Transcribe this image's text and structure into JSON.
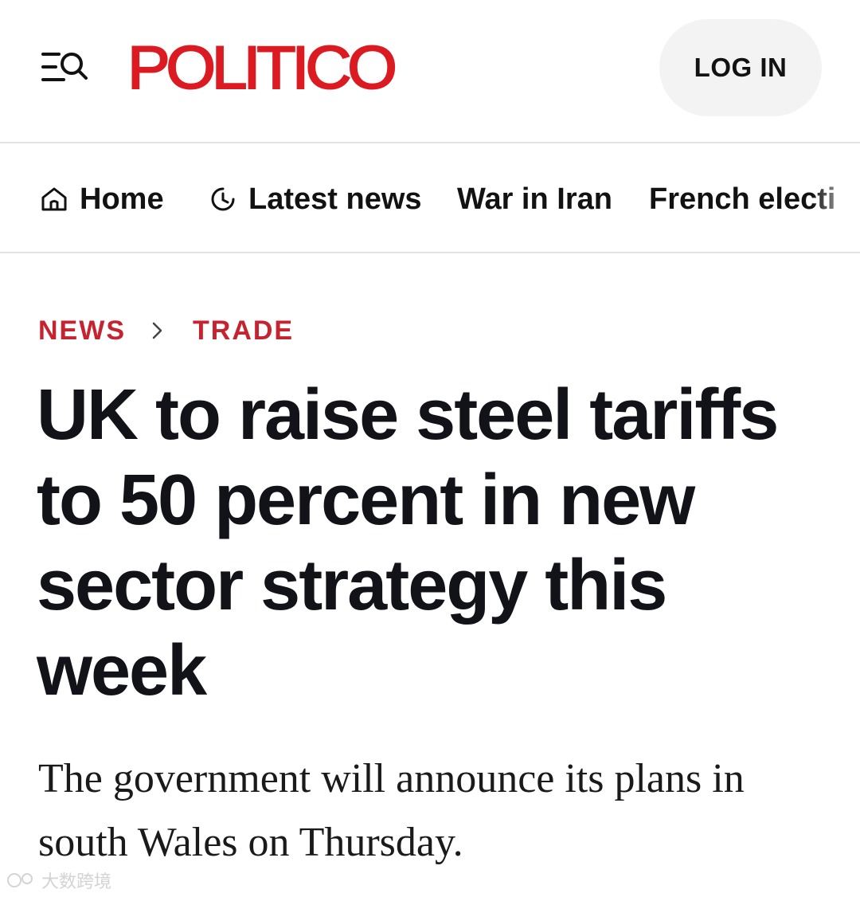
{
  "header": {
    "logo": "POLITICO",
    "login_label": "LOG IN"
  },
  "nav": {
    "items": [
      {
        "label": "Home",
        "icon": "home-icon"
      },
      {
        "label": "Latest news",
        "icon": "clock-icon"
      },
      {
        "label": "War in Iran"
      },
      {
        "label": "French electi"
      }
    ]
  },
  "breadcrumb": {
    "section": "NEWS",
    "subsection": "TRADE"
  },
  "article": {
    "headline": "UK to raise steel tariffs to 50 percent in new sector strategy this week",
    "dek": "The government will announce its plans in south Wales on Thursday."
  },
  "watermark": {
    "text": "大数跨境"
  },
  "colors": {
    "brand_red": "#dc1a22",
    "breadcrumb_red": "#c4232f",
    "text": "#121212",
    "login_bg": "#f3f3f3"
  }
}
